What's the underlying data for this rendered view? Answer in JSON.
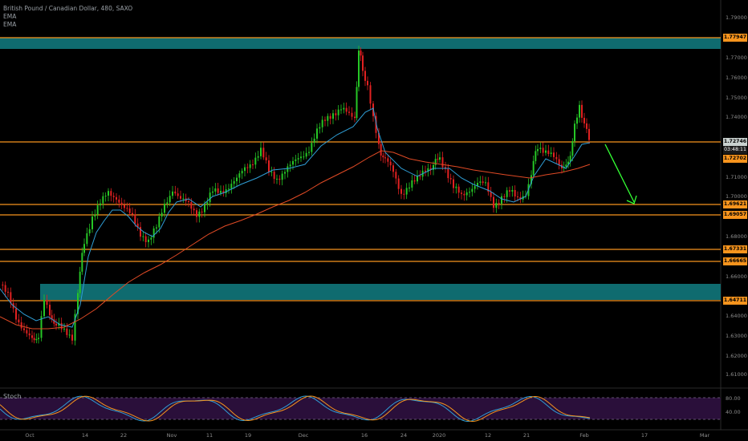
{
  "header": {
    "title": "British Pound / Canadian Dollar, 480, SAXO",
    "indicator_1": "EMA",
    "indicator_2": "EMA"
  },
  "oscillator": {
    "label": "Stoch",
    "level_high": "80.00",
    "level_low": "40.00"
  },
  "price_axis": [
    "1.79000",
    "1.77000",
    "1.76000",
    "1.75000",
    "1.74000",
    "1.71000",
    "1.70000",
    "1.68000",
    "1.66000",
    "1.64000",
    "1.63000",
    "1.62000",
    "1.61000"
  ],
  "price_tags": {
    "resistance_top": "1.77947",
    "current": "1.72746",
    "countdown": "03:48:11",
    "ema": "1.72702",
    "support_1": "1.69621",
    "support_2": "1.69057",
    "support_3": "1.67331",
    "support_4": "1.66665",
    "support_5": "1.64711"
  },
  "time_axis": [
    "Oct",
    "14",
    "22",
    "Nov",
    "11",
    "19",
    "Dec",
    "16",
    "24",
    "2020",
    "21",
    "12",
    "Feb",
    "17",
    "Mar"
  ],
  "colors": {
    "zone": "#0f6b6f",
    "level_line": "#f7941d",
    "candle_up": "#26c626",
    "candle_down": "#e22121",
    "ema_fast": "#2f9ed6",
    "ema_slow": "#e04a25",
    "arrow": "#33ff33",
    "stoch_bg": "#2a0f3a"
  },
  "chart_data": {
    "type": "candlestick",
    "levels": [
      1.77947,
      1.72746,
      1.69621,
      1.69057,
      1.67331,
      1.66665,
      1.64711
    ],
    "zones": [
      [
        1.7765,
        1.7795
      ],
      [
        1.6475,
        1.6545
      ]
    ]
  }
}
